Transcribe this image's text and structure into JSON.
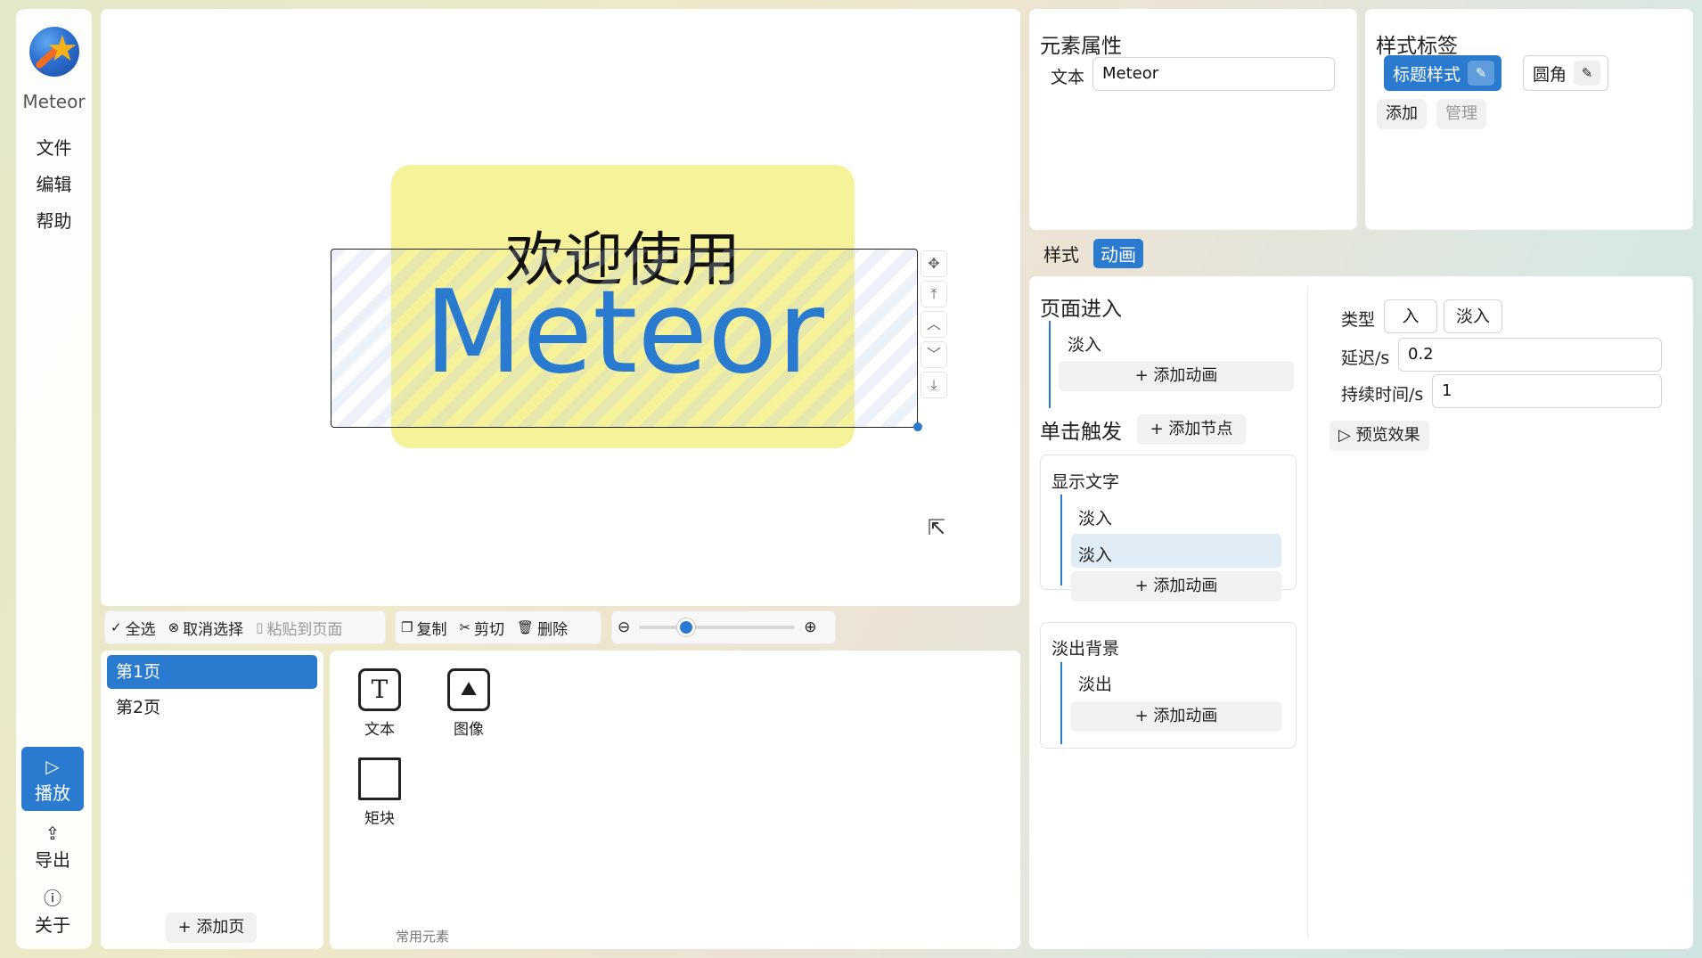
{
  "app": {
    "name": "Meteor"
  },
  "sidebar": {
    "menu": [
      "文件",
      "编辑",
      "帮助"
    ],
    "play_label": "播放",
    "export_label": "导出",
    "about_label": "关于"
  },
  "canvas": {
    "slide_title": "欢迎使用",
    "slide_main": "Meteor"
  },
  "toolbar": {
    "select_all": "全选",
    "deselect": "取消选择",
    "paste_to_page": "粘贴到页面",
    "copy": "复制",
    "cut": "剪切",
    "delete": "删除",
    "zoom_level": 0.3
  },
  "pages": {
    "items": [
      "第1页",
      "第2页"
    ],
    "active_index": 0,
    "add_label": "添加页"
  },
  "elements": {
    "items": [
      "文本",
      "图像",
      "矩块"
    ],
    "caption": "常用元素"
  },
  "props": {
    "title": "元素属性",
    "text_label": "文本",
    "text_value": "Meteor"
  },
  "style_tags": {
    "title": "样式标签",
    "tags": [
      "标题样式",
      "圆角"
    ],
    "add_label": "添加",
    "manage_label": "管理"
  },
  "tabs": {
    "style": "样式",
    "animation": "动画"
  },
  "animation": {
    "page_enter": {
      "title": "页面进入",
      "items": [
        "淡入"
      ],
      "add_label": "添加动画"
    },
    "click_trigger": {
      "title": "单击触发",
      "add_node_label": "添加节点"
    },
    "nodes": [
      {
        "title": "显示文字",
        "items": [
          "淡入",
          "淡入"
        ],
        "add_label": "添加动画"
      },
      {
        "title": "淡出背景",
        "items": [
          "淡出"
        ],
        "add_label": "添加动画"
      }
    ],
    "detail": {
      "type_label": "类型",
      "type_options": [
        "入",
        "淡入"
      ],
      "delay_label": "延迟/s",
      "delay_value": "0.2",
      "duration_label": "持续时间/s",
      "duration_value": "1",
      "preview_label": "预览效果"
    }
  },
  "colors": {
    "accent": "#2a7bd0",
    "slide_bg": "#f6f29a"
  }
}
